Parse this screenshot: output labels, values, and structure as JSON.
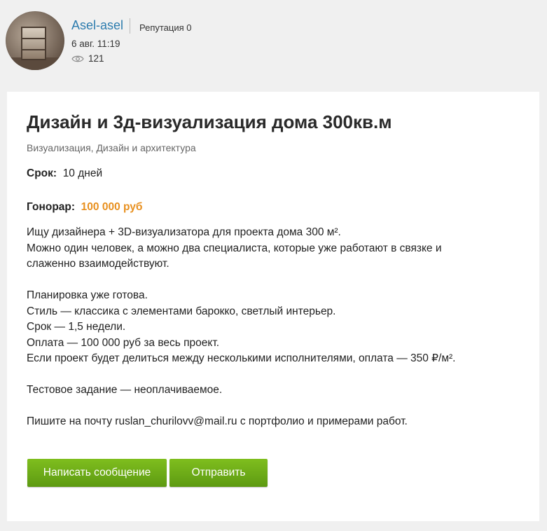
{
  "author": {
    "name": "Asel-asel",
    "reputation": "Репутация 0",
    "date": "6 авг. 11:19",
    "views": "121"
  },
  "post": {
    "title": "Дизайн и 3д-визуализация дома 300кв.м",
    "categories": "Визуализация, Дизайн и архитектура",
    "term_label": "Срок:",
    "term_value": "10 дней",
    "fee_label": "Гонорар:",
    "fee_value": "100 000 руб",
    "desc": [
      "Ищу дизайнера + 3D-визуализатора для проекта дома 300 м².",
      "Можно один человек, а можно два специалиста, которые уже работают в связке и",
      "слаженно взаимодействуют.",
      "",
      "Планировка уже готова.",
      "Стиль — классика с элементами барокко, светлый интерьер.",
      "Срок — 1,5 недели.",
      "Оплата — 100 000 руб за весь проект.",
      "Если проект будет делиться между несколькими исполнителями, оплата — 350 ₽/м².",
      "",
      "Тестовое задание — неоплачиваемое.",
      "",
      "Пишите на почту ruslan_churilovv@mail.ru с портфолио и примерами работ."
    ]
  },
  "buttons": {
    "message": "Написать сообщение",
    "send": "Отправить"
  },
  "colors": {
    "link": "#2d7cae",
    "fee": "#e8901f",
    "button": "#6ead18"
  }
}
